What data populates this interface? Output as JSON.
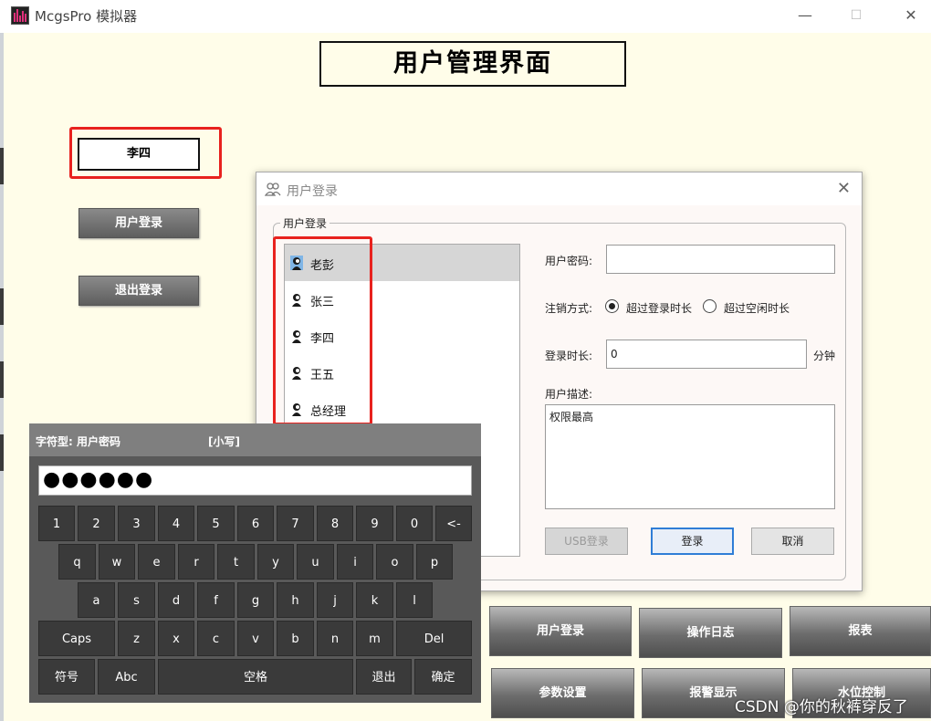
{
  "window": {
    "title": "McgsPro 模拟器",
    "minimize_icon": "minimize-icon",
    "maximize_icon": "maximize-icon",
    "close_icon": "close-icon"
  },
  "screen": {
    "page_title": "用户管理界面",
    "current_user": "李四",
    "left_buttons": [
      "用户登录",
      "退出登录"
    ],
    "bottom_buttons": [
      "用户登录",
      "操作日志",
      "报表",
      "参数设置",
      "报警显示",
      "水位控制"
    ]
  },
  "login_dialog": {
    "title": "用户登录",
    "group_label": "用户登录",
    "users": [
      "老彭",
      "张三",
      "李四",
      "王五",
      "总经理"
    ],
    "selected_user": "老彭",
    "password_label": "用户密码:",
    "password_value": "",
    "logout_mode_label": "注销方式:",
    "logout_options": [
      "超过登录时长",
      "超过空闲时长"
    ],
    "logout_selected": "超过登录时长",
    "duration_label": "登录时长:",
    "duration_value": "0",
    "duration_unit": "分钟",
    "description_label": "用户描述:",
    "description_value": "权限最高",
    "buttons": {
      "usb": "USB登录",
      "login": "登录",
      "cancel": "取消"
    }
  },
  "keyboard": {
    "type_label": "字符型: 用户密码",
    "case_label": "[小写]",
    "display": "●●●●●●",
    "row1": [
      "1",
      "2",
      "3",
      "4",
      "5",
      "6",
      "7",
      "8",
      "9",
      "0",
      "<-"
    ],
    "row2": [
      "q",
      "w",
      "e",
      "r",
      "t",
      "y",
      "u",
      "i",
      "o",
      "p"
    ],
    "row3": [
      "a",
      "s",
      "d",
      "f",
      "g",
      "h",
      "j",
      "k",
      "l"
    ],
    "row4": [
      "Caps",
      "z",
      "x",
      "c",
      "v",
      "b",
      "n",
      "m",
      "Del"
    ],
    "row5": [
      "符号",
      "Abc",
      "空格",
      "退出",
      "确定"
    ]
  },
  "watermark": "CSDN @你的秋裤穿反了",
  "colors": {
    "canvas_bg": "#fffde9",
    "highlight_frame": "#e8221e",
    "keyboard_bg": "#595959",
    "key_bg": "#3a3a3a",
    "focus_border": "#2f7dd6"
  }
}
